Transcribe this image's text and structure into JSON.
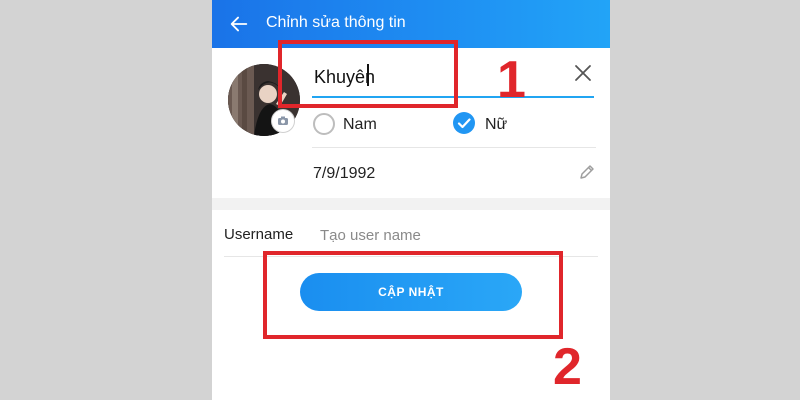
{
  "header": {
    "title": "Chỉnh sửa thông tin"
  },
  "profile": {
    "name_value": "Khuyên",
    "gender_options": [
      {
        "label": "Nam",
        "selected": false
      },
      {
        "label": "Nữ",
        "selected": true
      }
    ],
    "birthdate": "7/9/1992"
  },
  "username": {
    "label": "Username",
    "placeholder": "Tạo user name"
  },
  "actions": {
    "update_label": "CẬP NHẬT"
  },
  "annotations": {
    "step1": "1",
    "step2": "2"
  },
  "colors": {
    "header": "#1e8df2",
    "accent": "#2196f3",
    "annotation": "#e0262b"
  },
  "icons": [
    "back-arrow-icon",
    "close-icon",
    "camera-icon",
    "checkmark-icon",
    "pencil-icon"
  ]
}
